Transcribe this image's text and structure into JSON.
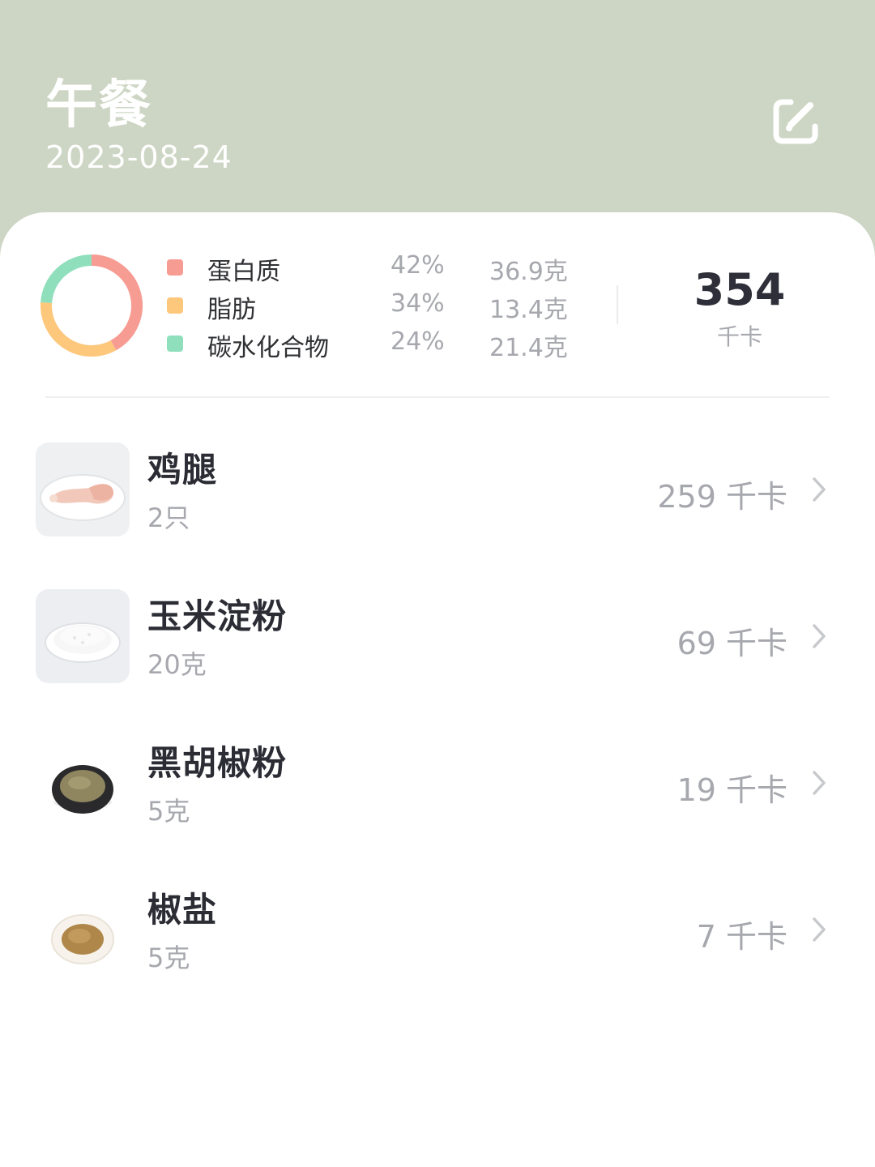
{
  "header": {
    "title": "午餐",
    "date": "2023-08-24",
    "edit_icon": "edit-icon"
  },
  "nutrition": {
    "chart_data": {
      "type": "pie",
      "categories": [
        "蛋白质",
        "脂肪",
        "碳水化合物"
      ],
      "values": [
        42,
        34,
        24
      ],
      "colors": [
        "#f79c93",
        "#fdc77c",
        "#8fdfbd"
      ]
    },
    "items": [
      {
        "name": "蛋白质",
        "percent": "42%",
        "amount": "36.9克",
        "color": "#f79c93"
      },
      {
        "name": "脂肪",
        "percent": "34%",
        "amount": "13.4克",
        "color": "#fdc77c"
      },
      {
        "name": "碳水化合物",
        "percent": "24%",
        "amount": "21.4克",
        "color": "#8fdfbd"
      }
    ],
    "total_kcal": "354",
    "kcal_unit": "千卡"
  },
  "foods": [
    {
      "name": "鸡腿",
      "quantity": "2只",
      "kcal": "259 千卡",
      "image": "chicken-leg-photo"
    },
    {
      "name": "玉米淀粉",
      "quantity": "20克",
      "kcal": "69 千卡",
      "image": "corn-starch-photo"
    },
    {
      "name": "黑胡椒粉",
      "quantity": "5克",
      "kcal": "19 千卡",
      "image": "black-pepper-photo"
    },
    {
      "name": "椒盐",
      "quantity": "5克",
      "kcal": "7 千卡",
      "image": "pepper-salt-photo"
    }
  ],
  "colors": {
    "header_bg": "#cdd6c4",
    "card_bg": "#ffffff",
    "primary_text": "#2b2c34",
    "secondary_text": "#a6a8ae"
  }
}
